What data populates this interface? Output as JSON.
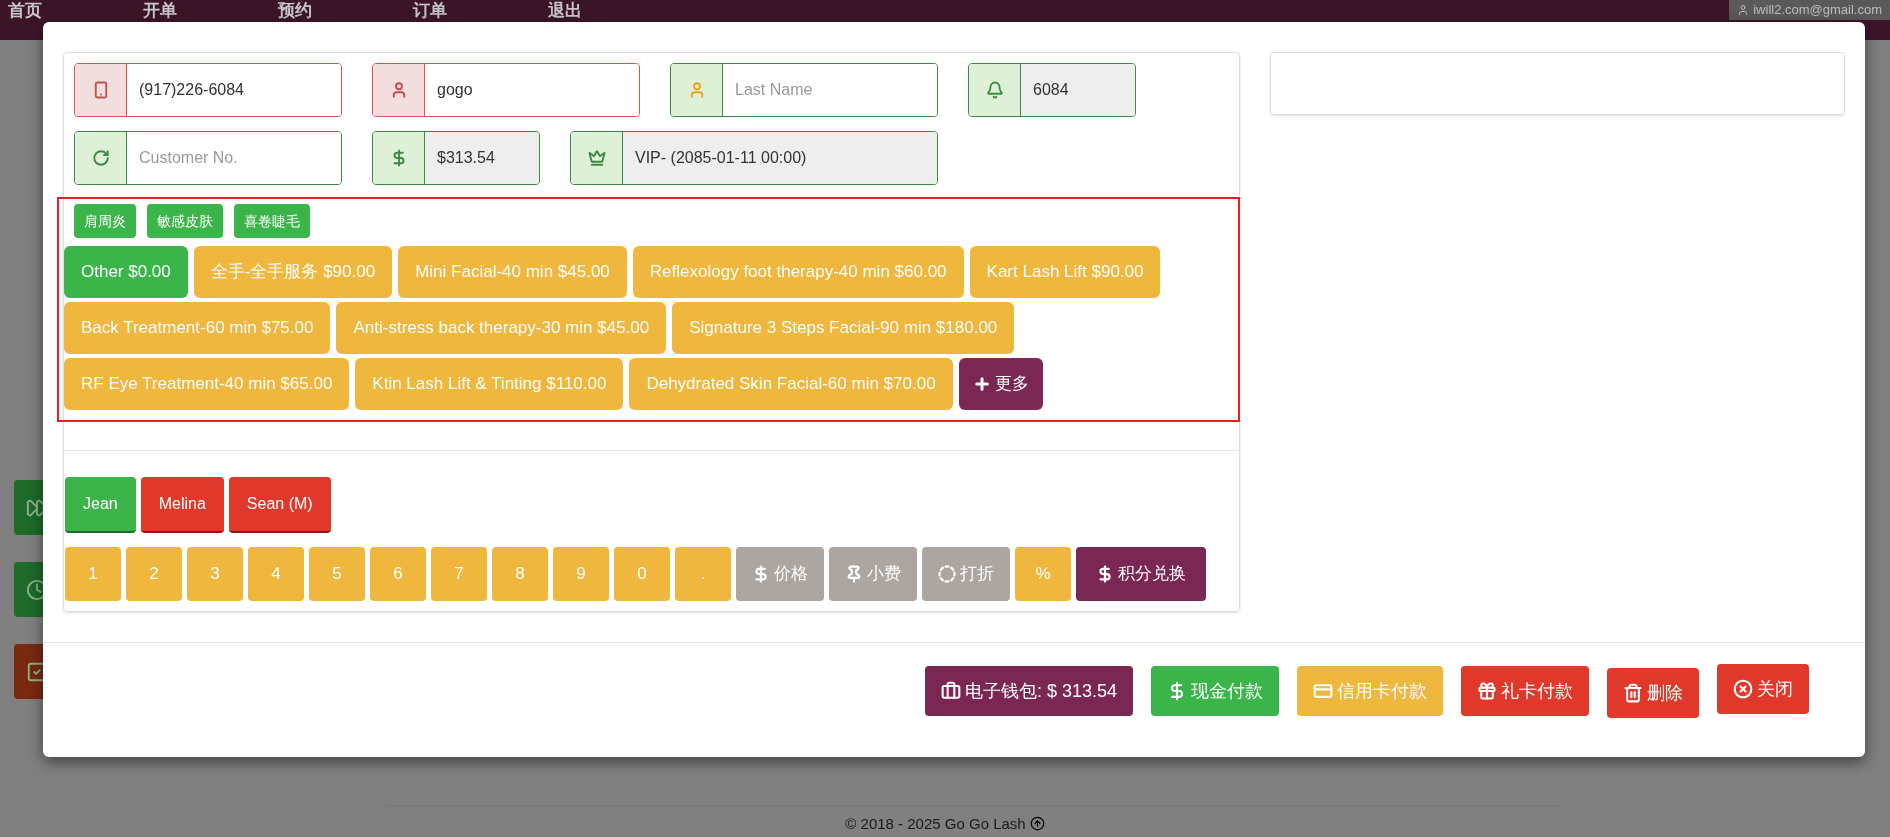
{
  "nav": {
    "items": [
      "首页",
      "开单",
      "预约",
      "订单",
      "退出"
    ],
    "user": "iwill2.com@gmail.com"
  },
  "background": {
    "side_buttons": [
      {
        "kind": "forward"
      },
      {
        "kind": "clock"
      },
      {
        "kind": "check"
      }
    ],
    "footer": "© 2018 - 2025 Go Go Lash"
  },
  "customer_fields": [
    {
      "kind": "phone",
      "invalid": true,
      "readonly": false,
      "value": "(917)226-6084"
    },
    {
      "kind": "person",
      "invalid": true,
      "readonly": false,
      "value": "gogo"
    },
    {
      "kind": "person_alt",
      "invalid": false,
      "readonly": false,
      "placeholder": "Last Name"
    },
    {
      "kind": "bell",
      "invalid": false,
      "readonly": true,
      "value": "6084"
    },
    {
      "kind": "refresh",
      "invalid": false,
      "readonly": false,
      "placeholder": "Customer No."
    },
    {
      "kind": "dollar",
      "invalid": false,
      "readonly": true,
      "value": "$313.54"
    },
    {
      "kind": "crown",
      "invalid": false,
      "readonly": true,
      "value": "VIP- (2085-01-11 00:00)"
    }
  ],
  "tags": [
    "肩周炎",
    "敏感皮肤",
    "喜卷睫毛"
  ],
  "service_rows": [
    [
      {
        "label": "Other $0.00",
        "selected": true
      },
      {
        "label": "全手-全手服务 $90.00",
        "selected": false
      },
      {
        "label": "Mini Facial-40 min $45.00",
        "selected": false
      },
      {
        "label": "Reflexology foot therapy-40 min $60.00",
        "selected": false
      },
      {
        "label": "Kart Lash Lift $90.00",
        "selected": false
      }
    ],
    [
      {
        "label": "Back Treatment-60 min $75.00",
        "selected": false
      },
      {
        "label": "Anti-stress back therapy-30 min $45.00",
        "selected": false
      },
      {
        "label": "Signature 3 Steps Facial-90 min $180.00",
        "selected": false
      }
    ],
    [
      {
        "label": "RF Eye Treatment-40 min $65.00",
        "selected": false
      },
      {
        "label": "Ktin Lash Lift & Tinting $110.00",
        "selected": false
      },
      {
        "label": "Dehydrated Skin Facial-60 min $70.00",
        "selected": false
      }
    ]
  ],
  "more_button": "更多",
  "staff": [
    {
      "name": "Jean",
      "selected": true
    },
    {
      "name": "Melina",
      "selected": false
    },
    {
      "name": "Sean (M)",
      "selected": false
    }
  ],
  "keypad": [
    {
      "kind": "key",
      "label": "1"
    },
    {
      "kind": "key",
      "label": "2"
    },
    {
      "kind": "key",
      "label": "3"
    },
    {
      "kind": "key",
      "label": "4"
    },
    {
      "kind": "key",
      "label": "5"
    },
    {
      "kind": "key",
      "label": "6"
    },
    {
      "kind": "key",
      "label": "7"
    },
    {
      "kind": "key",
      "label": "8"
    },
    {
      "kind": "key",
      "label": "9"
    },
    {
      "kind": "key",
      "label": "0"
    },
    {
      "kind": "key",
      "label": "."
    },
    {
      "kind": "price",
      "label": "价格"
    },
    {
      "kind": "tip",
      "label": "小费"
    },
    {
      "kind": "discount",
      "label": "打折"
    },
    {
      "kind": "key",
      "label": "%"
    },
    {
      "kind": "redeem",
      "label": "积分兑换"
    }
  ],
  "actions": [
    {
      "kind": "wallet",
      "label": "电子钱包: $ 313.54"
    },
    {
      "kind": "cash",
      "label": "现金付款"
    },
    {
      "kind": "card",
      "label": "信用卡付款"
    },
    {
      "kind": "gift",
      "label": "礼卡付款"
    },
    {
      "kind": "delete",
      "label": "删除"
    },
    {
      "kind": "close",
      "label": "关闭"
    }
  ]
}
